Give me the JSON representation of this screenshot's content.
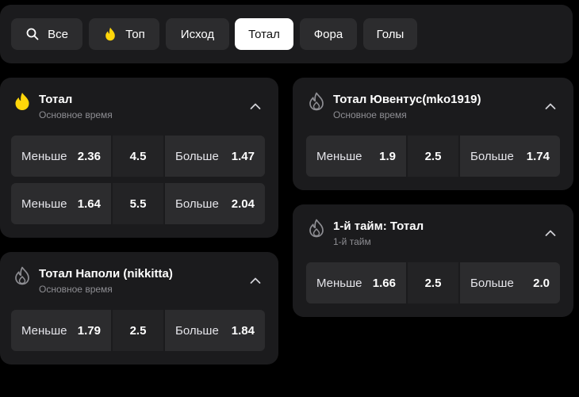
{
  "filters": [
    {
      "label": "Все",
      "icon": "search-icon",
      "active": false
    },
    {
      "label": "Топ",
      "icon": "fire-icon",
      "active": false
    },
    {
      "label": "Исход",
      "icon": "",
      "active": false
    },
    {
      "label": "Тотал",
      "icon": "",
      "active": true
    },
    {
      "label": "Фора",
      "icon": "",
      "active": false
    },
    {
      "label": "Голы",
      "icon": "",
      "active": false
    }
  ],
  "markets": [
    {
      "title": "Тотал",
      "subtitle": "Основное время",
      "icon": "fire-filled-icon",
      "rows": [
        {
          "under_label": "Меньше",
          "under_odd": "2.36",
          "line": "4.5",
          "over_label": "Больше",
          "over_odd": "1.47"
        },
        {
          "under_label": "Меньше",
          "under_odd": "1.64",
          "line": "5.5",
          "over_label": "Больше",
          "over_odd": "2.04"
        }
      ]
    },
    {
      "title": "Тотал Ювентус(mko1919)",
      "subtitle": "Основное время",
      "icon": "fire-outline-icon",
      "rows": [
        {
          "under_label": "Меньше",
          "under_odd": "1.9",
          "line": "2.5",
          "over_label": "Больше",
          "over_odd": "1.74"
        }
      ]
    },
    {
      "title": "Тотал Наполи (nikkitta)",
      "subtitle": "Основное время",
      "icon": "fire-outline-icon",
      "rows": [
        {
          "under_label": "Меньше",
          "under_odd": "1.79",
          "line": "2.5",
          "over_label": "Больше",
          "over_odd": "1.84"
        }
      ]
    },
    {
      "title": "1-й тайм: Тотал",
      "subtitle": "1-й тайм",
      "icon": "fire-outline-icon",
      "rows": [
        {
          "under_label": "Меньше",
          "under_odd": "1.66",
          "line": "2.5",
          "over_label": "Больше",
          "over_odd": "2.0"
        }
      ]
    }
  ],
  "colors": {
    "background": "#000000",
    "card": "#1b1b1d",
    "cell": "#2c2c2e",
    "accent_yellow": "#ffd60a",
    "muted_text": "#8e8e93"
  }
}
